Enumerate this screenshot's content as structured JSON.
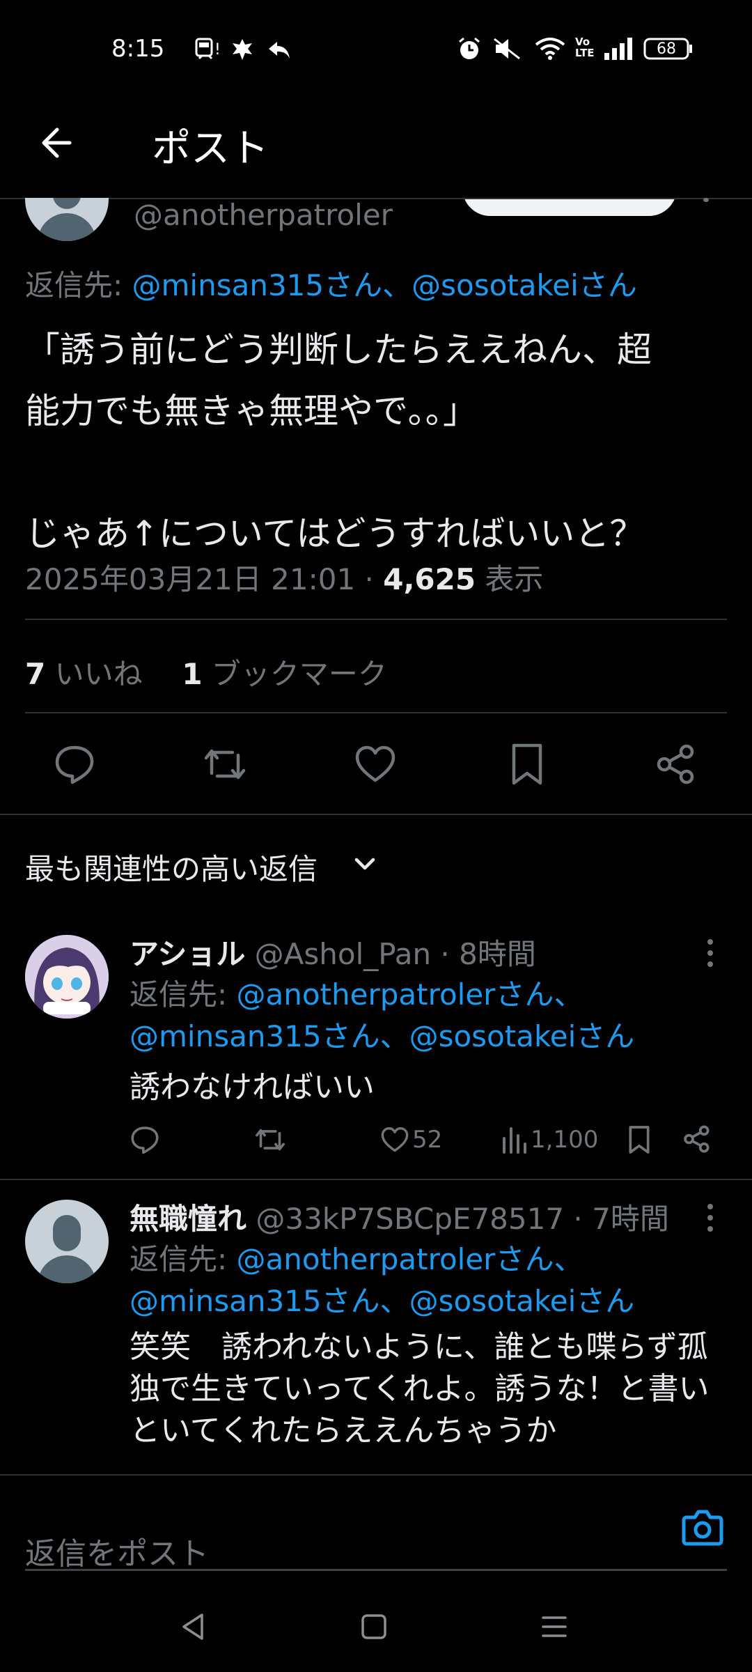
{
  "status_bar": {
    "time": "8:15",
    "battery": "68"
  },
  "header": {
    "title": "ポスト"
  },
  "post": {
    "handle": "@anotherpatroler",
    "reply_prefix": "返信先: ",
    "reply_targets": "@minsan315さん、@sosotakeiさん",
    "text_line1": "「誘う前にどう判断したらええねん、超",
    "text_line2": "能力でも無きゃ無理やで｡｡」",
    "text_line3": "じゃあ↑についてはどうすればいいと？",
    "timestamp": "2025年03月21日 21:01 · ",
    "views_count": "4,625",
    "views_label": " 表示",
    "likes_count": "7",
    "likes_label": " いいね",
    "bookmarks_count": "1",
    "bookmarks_label": " ブックマーク"
  },
  "replies_section": {
    "label": "最も関連性の高い返信"
  },
  "replies": [
    {
      "name": "アショル",
      "meta": " @Ashol_Pan · 8時間",
      "reply_prefix": "返信先: ",
      "reply_targets_1": "@anotherpatrolerさん、",
      "reply_targets_2": "@minsan315さん、@sosotakeiさん",
      "text": "誘わなければいい",
      "likes": "52",
      "views": "1,100"
    },
    {
      "name": "無職憧れ",
      "meta": " @33kP7SBCpE78517 · 7時間",
      "reply_prefix": "返信先: ",
      "reply_targets_1": "@anotherpatrolerさん、",
      "reply_targets_2": "@minsan315さん、@sosotakeiさん",
      "text_line1": "笑笑　誘われないように、誰とも喋らず孤",
      "text_line2": "独で生きていってくれよ。誘うな！と書い",
      "text_line3": "といてくれたらええんちゃうか"
    }
  ],
  "composer": {
    "placeholder": "返信をポスト"
  },
  "colors": {
    "accent": "#1d9bf0",
    "background": "#000000",
    "secondary_text": "#71767b",
    "divider": "#2f3336"
  }
}
